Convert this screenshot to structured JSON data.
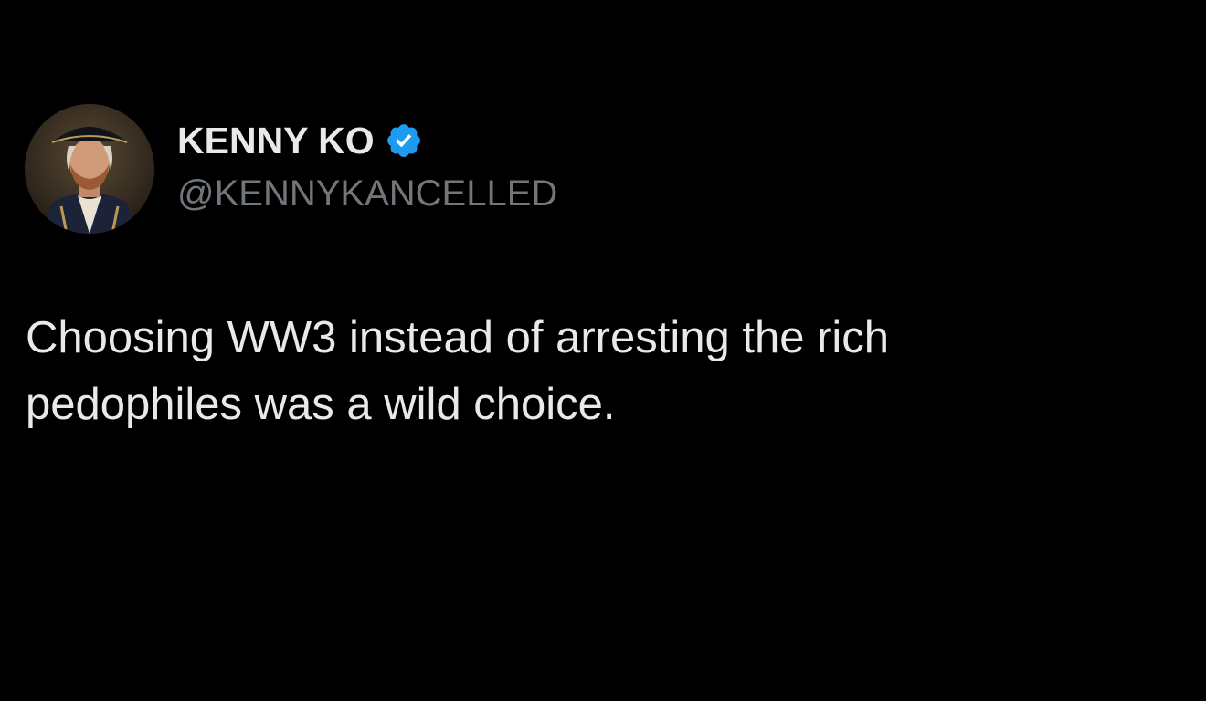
{
  "tweet": {
    "author": {
      "display_name": "KENNY KO",
      "handle": "@KENNYKANCELLED",
      "verified": true,
      "avatar_icon": "avatar-icon"
    },
    "text_lines": [
      "Choosing WW3 instead of arresting the rich",
      "pedophiles was a wild choice."
    ]
  },
  "colors": {
    "background": "#000000",
    "primary_text": "#e7e9ea",
    "secondary_text": "#71767b",
    "verified_badge": "#1d9bf0"
  }
}
